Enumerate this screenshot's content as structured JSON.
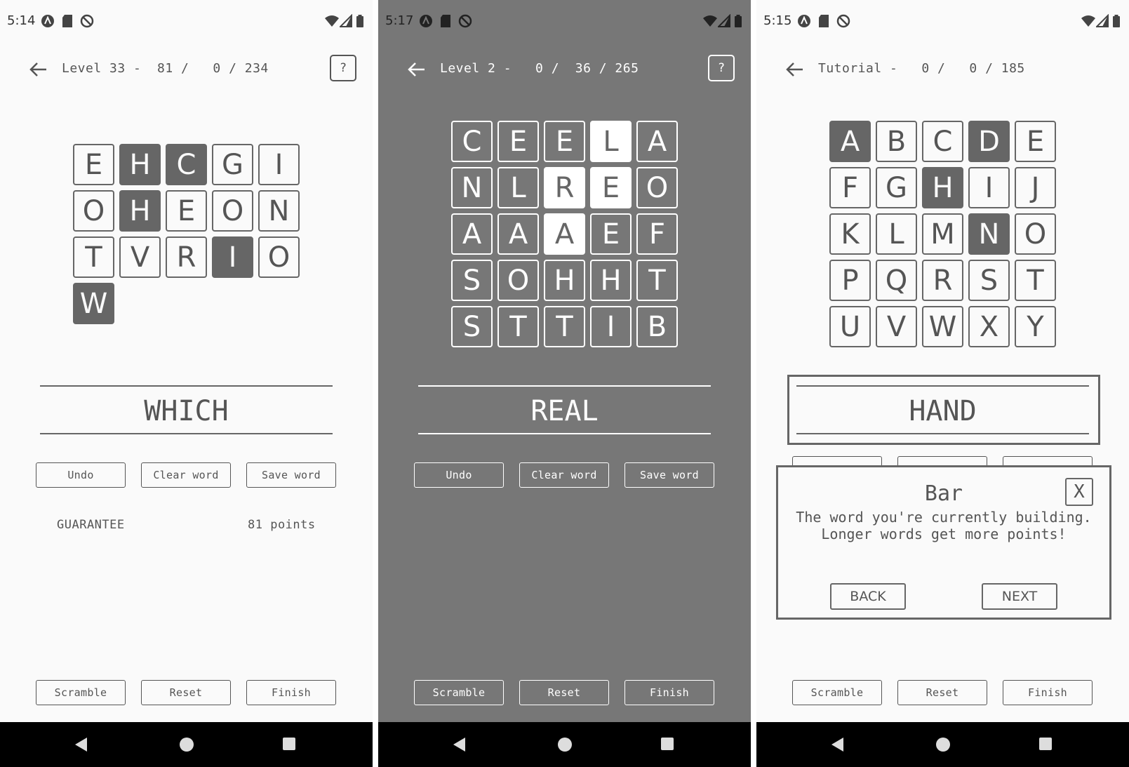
{
  "colors": {
    "light_bg": "#fafafa",
    "dark_bg": "#777777",
    "tile_dark": "#666666",
    "text": "#555555",
    "navbar": "#000000"
  },
  "screens": [
    {
      "status_time": "5:14",
      "title": "Level 33 -  81 /   0 / 234",
      "current_word": "WHICH",
      "buttons": {
        "undo": "Undo",
        "clear": "Clear word",
        "save": "Save word",
        "scramble": "Scramble",
        "reset": "Reset",
        "finish": "Finish"
      },
      "help_label": "?",
      "saved_words": [
        {
          "word": "GUARANTEE",
          "points": "81 points"
        }
      ],
      "tiles": [
        [
          "E",
          "H",
          "C",
          "G",
          "I"
        ],
        [
          "O",
          "H",
          "E",
          "O",
          "N"
        ],
        [
          "T",
          "V",
          "R",
          "I",
          "O"
        ],
        [
          "W"
        ]
      ],
      "selected": [
        [
          0,
          1
        ],
        [
          0,
          2
        ],
        [
          1,
          1
        ],
        [
          2,
          3
        ],
        [
          3,
          0
        ]
      ],
      "icons": [
        "auto-icon",
        "sd-card-icon",
        "no-disturb-icon",
        "wifi-icon",
        "signal-icon",
        "battery-icon"
      ]
    },
    {
      "status_time": "5:17",
      "title": "Level 2 -   0 /  36 / 265",
      "current_word": "REAL",
      "buttons": {
        "undo": "Undo",
        "clear": "Clear word",
        "save": "Save word",
        "scramble": "Scramble",
        "reset": "Reset",
        "finish": "Finish"
      },
      "help_label": "?",
      "saved_words": [],
      "tiles": [
        [
          "C",
          "E",
          "E",
          "L",
          "A"
        ],
        [
          "N",
          "L",
          "R",
          "E",
          "O"
        ],
        [
          "A",
          "A",
          "A",
          "E",
          "F"
        ],
        [
          "S",
          "O",
          "H",
          "H",
          "T"
        ],
        [
          "S",
          "T",
          "T",
          "I",
          "B"
        ]
      ],
      "selected": [
        [
          0,
          3
        ],
        [
          1,
          2
        ],
        [
          1,
          3
        ],
        [
          2,
          2
        ]
      ]
    },
    {
      "status_time": "5:15",
      "title": "Tutorial -   0 /   0 / 185",
      "current_word": "HAND",
      "buttons": {
        "scramble": "Scramble",
        "reset": "Reset",
        "finish": "Finish"
      },
      "tiles": [
        [
          "A",
          "B",
          "C",
          "D",
          "E"
        ],
        [
          "F",
          "G",
          "H",
          "I",
          "J"
        ],
        [
          "K",
          "L",
          "M",
          "N",
          "O"
        ],
        [
          "P",
          "Q",
          "R",
          "S",
          "T"
        ],
        [
          "U",
          "V",
          "W",
          "X",
          "Y"
        ]
      ],
      "selected": [
        [
          0,
          0
        ],
        [
          0,
          3
        ],
        [
          1,
          2
        ],
        [
          2,
          3
        ]
      ],
      "dialog": {
        "title": "Bar",
        "body": "The word you're currently building. Longer words get more points!",
        "close": "X",
        "back": "BACK",
        "next": "NEXT"
      }
    }
  ]
}
